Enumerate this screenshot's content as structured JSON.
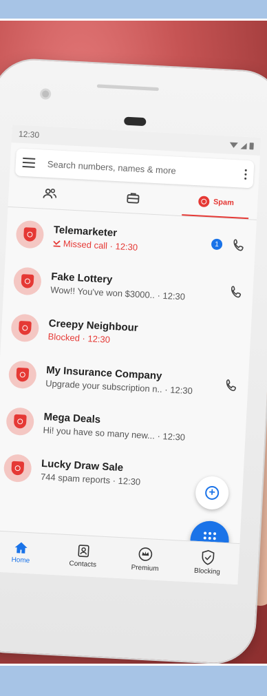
{
  "status": {
    "time": "12:30"
  },
  "search": {
    "placeholder": "Search numbers, names & more"
  },
  "tabs": [
    {
      "id": "contacts",
      "icon": "people-icon"
    },
    {
      "id": "business",
      "icon": "briefcase-icon"
    },
    {
      "id": "spam",
      "label": "Spam",
      "icon": "spam-shield-icon",
      "active": true
    }
  ],
  "calls": [
    {
      "name": "Telemarketer",
      "sub": "Missed call · 12:30",
      "sub_style": "missed",
      "badge": "1",
      "has_call": true
    },
    {
      "name": "Fake Lottery",
      "sub": "Wow!! You've won $3000.. · 12:30",
      "has_call": true
    },
    {
      "name": "Creepy Neighbour",
      "sub": "Blocked · 12:30",
      "sub_style": "blocked"
    },
    {
      "name": "My Insurance Company",
      "sub": "Upgrade your subscription n.. · 12:30",
      "has_call": true
    },
    {
      "name": "Mega Deals",
      "sub": "Hi! you have so many new... · 12:30"
    },
    {
      "name": "Lucky Draw Sale",
      "sub": "744 spam reports · 12:30"
    }
  ],
  "nav": [
    {
      "label": "Home",
      "icon": "home-icon",
      "active": true
    },
    {
      "label": "Contacts",
      "icon": "contacts-icon"
    },
    {
      "label": "Premium",
      "icon": "crown-icon"
    },
    {
      "label": "Blocking",
      "icon": "shield-check-icon"
    }
  ],
  "colors": {
    "accent": "#1a73e8",
    "spam": "#e53935",
    "avatar_bg": "#f4c7c3",
    "frame_band": "#a7c4e6"
  }
}
